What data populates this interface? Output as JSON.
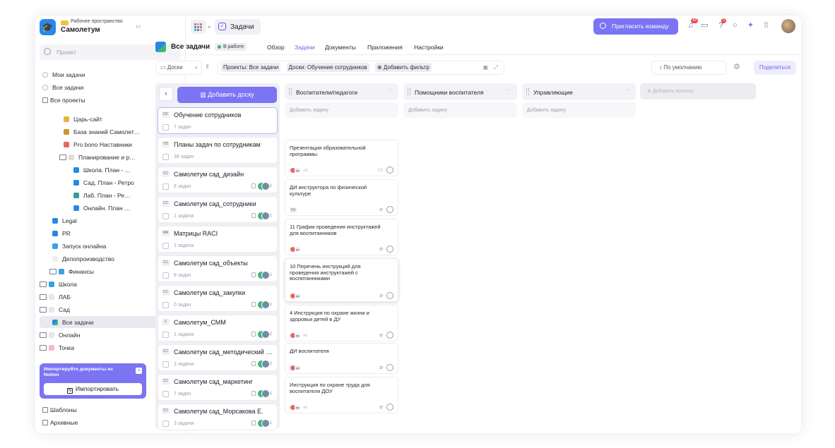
{
  "workspace": {
    "label": "Рабочее пространство",
    "name": "Самолетум",
    "collapse": "‹‹"
  },
  "sidebar": {
    "search_placeholder": "Проект",
    "items": [
      {
        "label": "Мои задачи"
      },
      {
        "label": "Все задачи"
      },
      {
        "label": "Все проекты"
      },
      {
        "label": "Царь-сайт"
      },
      {
        "label": "База знаний Самолет…"
      },
      {
        "label": "Pro bono Наставники"
      },
      {
        "label": "Планирование и р…"
      },
      {
        "label": "Школа. План - …"
      },
      {
        "label": "Сад. План - Ретро"
      },
      {
        "label": "Лаб. План - Ре…"
      },
      {
        "label": "Онлайн. План …"
      },
      {
        "label": "Legal"
      },
      {
        "label": "PR"
      },
      {
        "label": "Запуск онлайна"
      },
      {
        "label": "Делопроизводство"
      },
      {
        "label": "Финансы"
      },
      {
        "label": "Школа"
      },
      {
        "label": "ЛАБ"
      },
      {
        "label": "Сад"
      },
      {
        "label": "Все задачи"
      },
      {
        "label": "Онлайн"
      },
      {
        "label": "Точка"
      }
    ],
    "import_banner": {
      "text": "Импортируйте документы из Notion",
      "button": "Импортировать",
      "close": "×"
    },
    "bottom": [
      {
        "label": "Шаблоны"
      },
      {
        "label": "Архивные"
      }
    ]
  },
  "topbar": {
    "tab": "Задачи",
    "invite": "Пригласить команду",
    "badge_bell": "43",
    "badge_help": "3"
  },
  "project": {
    "title": "Все задачи",
    "status": "В работе",
    "nav": [
      "Обзор",
      "Задачи",
      "Документы",
      "Приложения",
      "Настройки"
    ]
  },
  "toolbar": {
    "boards": "Доски",
    "projects_label": "Проекты:",
    "projects_value": "Все задачи",
    "boards_label": "Доски:",
    "boards_value": "Обучение сотрудников",
    "add_filter": "Добавить фильтр",
    "sort": "По умолчанию",
    "share": "Поделиться"
  },
  "board_panel": {
    "add_board": "Добавить доску",
    "boards": [
      {
        "badge": "OC",
        "name": "Обучение сотрудников",
        "count": "7 задач"
      },
      {
        "badge": "ПЗ",
        "name": "Планы задач по сотрудникам",
        "count": "39 задач"
      },
      {
        "badge": "СС",
        "name": "Самолетум сад_дизайн",
        "count": "8 задач",
        "more": "+2"
      },
      {
        "badge": "СС",
        "name": "Самолетум сад_сотрудники",
        "count": "1 задача",
        "more": "+1"
      },
      {
        "badge": "МR",
        "name": "Матрицы RACI",
        "count": "1 задача"
      },
      {
        "badge": "СС",
        "name": "Самолетум сад_объекты",
        "count": "8 задач",
        "more": "+1"
      },
      {
        "badge": "СС",
        "name": "Самолетум сад_закупки",
        "count": "0 задач",
        "more": "+1"
      },
      {
        "badge": "С",
        "name": "Самолетум_СММ",
        "count": "1 задача",
        "more": "+2"
      },
      {
        "badge": "СС",
        "name": "Самолетум сад_методический …",
        "count": "3 задачи",
        "more": "+2"
      },
      {
        "badge": "СС",
        "name": "Самолетум сад_маркетинг",
        "count": "7 задач",
        "more": "+1"
      },
      {
        "badge": "СС",
        "name": "Самолетум сад_Морсакова Е.",
        "count": "3 задачи",
        "more": "+1"
      }
    ]
  },
  "columns": [
    {
      "title": "Воспитатели/педагоги",
      "add": "Добавить задачу",
      "menu": "··· ",
      "tasks": [
        {
          "title": "Презентация образовательной программы",
          "initials": "РУ",
          "more": "+1"
        },
        {
          "title": "ДИ инструктора по физической культуре",
          "initials": "КК",
          "more": ""
        },
        {
          "title": "11 График проведения инструктажей для воспитанников",
          "initials": "РУ",
          "more": ""
        },
        {
          "title": "10 Перечень инструкций для проведения инструктажей с воспитанниками",
          "initials": "РУ",
          "more": ""
        },
        {
          "title": "4 Инструкция по охране жизни и здоровья детей в ДУ",
          "initials": "РУ",
          "more": "+1"
        },
        {
          "title": "ДИ воспитателя",
          "initials": "РУ",
          "more": ""
        },
        {
          "title": "Инструкция по охране труда для воспитателя ДОУ",
          "initials": "РУ",
          "more": "+1"
        }
      ]
    },
    {
      "title": "Помощники воспитателя",
      "add": "Добавить задачу",
      "menu": "··· "
    },
    {
      "title": "Управляющие",
      "add": "Добавить задачу",
      "menu": "··· "
    }
  ],
  "add_column": "Добавить колонку"
}
